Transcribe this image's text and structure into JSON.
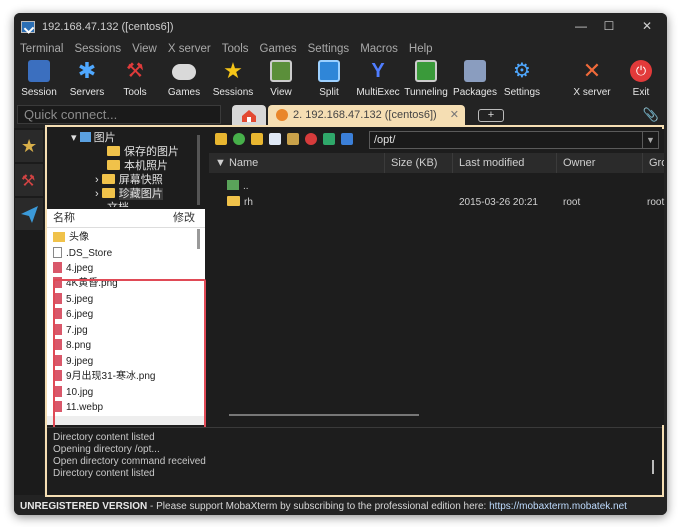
{
  "window": {
    "title": "192.168.47.132 ([centos6])"
  },
  "menu": [
    "Terminal",
    "Sessions",
    "View",
    "X server",
    "Tools",
    "Games",
    "Settings",
    "Macros",
    "Help"
  ],
  "toolbar": [
    "Session",
    "Servers",
    "Tools",
    "Games",
    "Sessions",
    "View",
    "Split",
    "MultiExec",
    "Tunneling",
    "Packages",
    "Settings",
    "X server",
    "Exit"
  ],
  "quick_connect": {
    "placeholder": "Quick connect..."
  },
  "tabs": {
    "active_label": "2. 192.168.47.132 ([centos6])"
  },
  "tree": {
    "items": [
      "图片",
      "保存的图片",
      "本机照片",
      "屏幕快照",
      "珍藏图片",
      "文档"
    ]
  },
  "local_files": {
    "header_name": "名称",
    "header_modified": "修改",
    "items": [
      "头像",
      ".DS_Store",
      "4.jpeg",
      "4K黄昏.png",
      "5.jpeg",
      "6.jpeg",
      "7.jpg",
      "8.png",
      "9.jpeg",
      "9月出现31-寒冰.png",
      "10.jpg",
      "11.webp"
    ]
  },
  "remote": {
    "path": "/opt/",
    "columns": [
      "Name",
      "Size (KB)",
      "Last modified",
      "Owner",
      "Gro"
    ],
    "rows": [
      {
        "name": "..",
        "size": "",
        "modified": "",
        "owner": "",
        "group": ""
      },
      {
        "name": "rh",
        "size": "",
        "modified": "2015-03-26 20:21",
        "owner": "root",
        "group": "root"
      }
    ]
  },
  "log": [
    "Directory content listed",
    "Opening directory /opt...",
    "Open directory command received",
    "Directory content listed"
  ],
  "status": {
    "version": "UNREGISTERED VERSION",
    "message": "-  Please support MobaXterm by subscribing to the professional edition here:",
    "link": "https://mobaxterm.mobatek.net"
  },
  "colors": {
    "accent_tab": "#f5deb3",
    "highlight_box": "#e04a56"
  }
}
